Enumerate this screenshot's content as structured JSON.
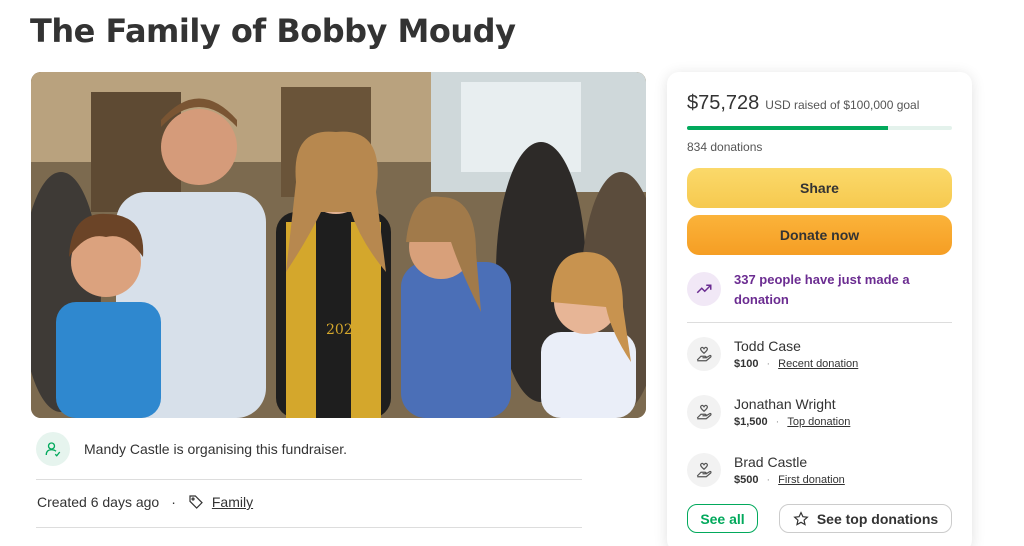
{
  "page": {
    "title": "The Family of Bobby Moudy"
  },
  "photo": {
    "caption_on_gown": "2022"
  },
  "organiser": {
    "text": "Mandy Castle is organising this fundraiser."
  },
  "meta": {
    "created": "Created 6 days ago",
    "separator": "·",
    "category": "Family"
  },
  "card": {
    "amount": "$75,728",
    "goal_text": "USD raised of $100,000 goal",
    "progress_fraction": 0.757,
    "donations_count": "834 donations",
    "share_label": "Share",
    "donate_label": "Donate now",
    "trend_text": "337 people have just made a donation",
    "donors": [
      {
        "name": "Todd Case",
        "amount": "$100",
        "type": "Recent donation"
      },
      {
        "name": "Jonathan Wright",
        "amount": "$1,500",
        "type": "Top donation"
      },
      {
        "name": "Brad Castle",
        "amount": "$500",
        "type": "First donation"
      }
    ],
    "donor_separator": "·",
    "see_all_label": "See all",
    "see_top_label": "See top donations"
  },
  "colors": {
    "brand_green": "#02a95c",
    "share_yellow": "#f6c94f",
    "donate_orange": "#f59e24",
    "trend_purple": "#6b2c91"
  },
  "icons": {
    "organiser": "user-icon",
    "tag": "tag-icon",
    "trend": "trending-up-icon",
    "donor": "donor-hand-heart-icon",
    "star": "star-icon"
  }
}
